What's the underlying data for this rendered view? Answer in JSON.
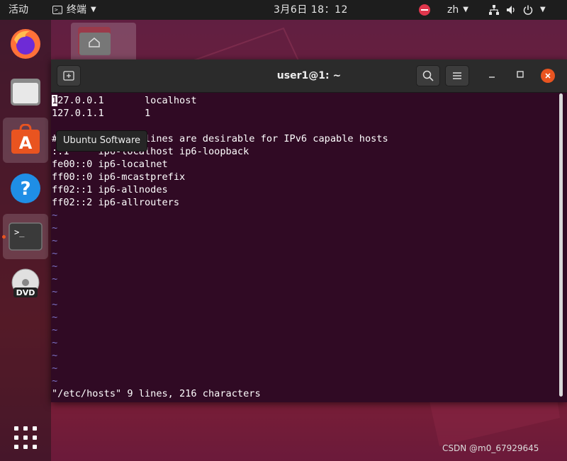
{
  "topbar": {
    "activities": "活动",
    "app_menu": "终端",
    "clock": "3月6日  18：12",
    "lang": "zh"
  },
  "dock": {
    "items": [
      {
        "name": "firefox",
        "icon": "firefox-icon"
      },
      {
        "name": "files",
        "icon": "folder-icon"
      },
      {
        "name": "ubuntu-software",
        "icon": "software-center-icon"
      },
      {
        "name": "help",
        "icon": "help-icon"
      },
      {
        "name": "terminal",
        "icon": "terminal-icon",
        "running": true
      },
      {
        "name": "dvd",
        "icon": "dvd-icon"
      }
    ],
    "tooltip": "Ubuntu Software"
  },
  "terminal": {
    "title": "user1@1: ~",
    "lines": [
      {
        "text": "127.0.0.1       localhost",
        "cursor_first": true
      },
      {
        "text": "127.0.1.1       1"
      },
      {
        "text": ""
      },
      {
        "text": "# The following lines are desirable for IPv6 capable hosts"
      },
      {
        "text": "::1     ip6-localhost ip6-loopback"
      },
      {
        "text": "fe00::0 ip6-localnet"
      },
      {
        "text": "ff00::0 ip6-mcastprefix"
      },
      {
        "text": "ff02::1 ip6-allnodes"
      },
      {
        "text": "ff02::2 ip6-allrouters"
      }
    ],
    "tilde_count": 14,
    "status_line": "\"/etc/hosts\" 9 lines, 216 characters"
  },
  "watermark": "CSDN @m0_67929645",
  "colors": {
    "terminal_bg": "#300a24",
    "accent": "#e95420",
    "tilde": "#7c74c9",
    "topbar": "#1d1d1d"
  }
}
